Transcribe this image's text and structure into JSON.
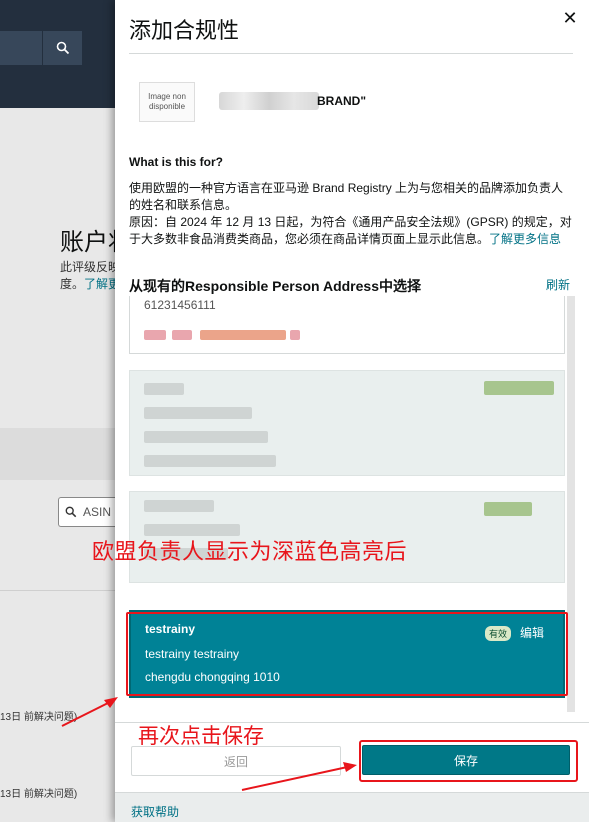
{
  "background": {
    "title": "账户状",
    "text_line1": "此评级反映",
    "text_line2_prefix": "度。",
    "text_line2_link": "了解更",
    "asin_placeholder": "ASIN",
    "row1": "13日 前解决问题)",
    "row2": "13日 前解决问题)"
  },
  "modal": {
    "title": "添加合规性",
    "brand": {
      "image_placeholder": "Image non disponible",
      "name_suffix": "BRAND\""
    },
    "what_title": "What is this for?",
    "desc_line1": "使用欧盟的一种官方语言在亚马逊 Brand Registry 上为与您相关的品牌添加负责人的姓名和联系信息。",
    "desc_line2": "原因：自 2024 年 12 月 13 日起，为符合《通用产品安全法规》(GPSR) 的规定，对于大多数非食品消费类商品，您必须在商品详情页面上显示此信息。",
    "desc_link": "了解更多信息",
    "select_title": "从现有的Responsible Person Address中选择",
    "refresh_label": "刷新",
    "partial_card_phone": "61231456111",
    "active_card": {
      "name": "testrainy",
      "line2": "testrainy testrainy",
      "line3": "chengdu chongqing 1010",
      "badge": "有效",
      "edit_label": "编辑"
    },
    "back_label": "返回",
    "save_label": "保存",
    "help_label": "获取帮助"
  },
  "annotations": {
    "note1": "欧盟负责人显示为深蓝色高亮后",
    "note2": "再次点击保存",
    "color": "#e8151b"
  },
  "colors": {
    "header_bg": "#232f3e",
    "active_card_bg": "#008296",
    "save_button_bg": "#007887",
    "link": "#007185"
  }
}
